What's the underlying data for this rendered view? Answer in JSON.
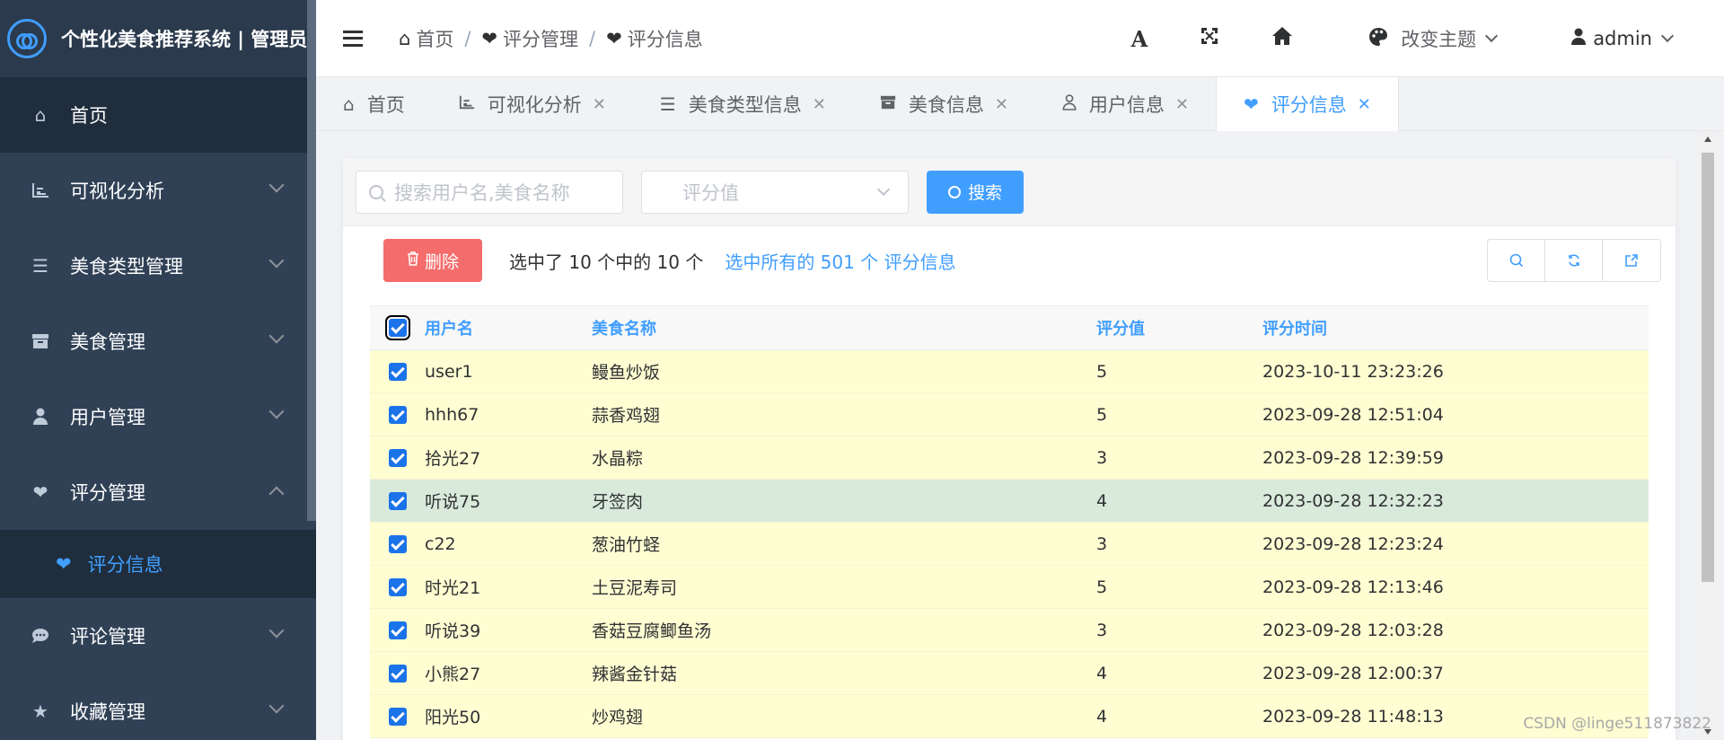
{
  "brand": {
    "title": "个性化美食推荐系统 | 管理员"
  },
  "sidebar": {
    "items": [
      {
        "label": "首页",
        "icon": "home-icon"
      },
      {
        "label": "可视化分析",
        "icon": "chart-icon"
      },
      {
        "label": "美食类型管理",
        "icon": "list-icon"
      },
      {
        "label": "美食管理",
        "icon": "box-icon"
      },
      {
        "label": "用户管理",
        "icon": "user-icon"
      },
      {
        "label": "评分管理",
        "icon": "heart-icon"
      },
      {
        "label": "评论管理",
        "icon": "comment-icon"
      },
      {
        "label": "收藏管理",
        "icon": "star-icon"
      }
    ],
    "sub_item": {
      "label": "评分信息",
      "icon": "heart-icon"
    }
  },
  "header": {
    "breadcrumb": [
      "首页",
      "评分管理",
      "评分信息"
    ],
    "theme_label": "改变主题",
    "user": "admin"
  },
  "tags": [
    {
      "label": "首页",
      "icon": "home-icon"
    },
    {
      "label": "可视化分析",
      "icon": "chart-icon"
    },
    {
      "label": "美食类型信息",
      "icon": "list-icon"
    },
    {
      "label": "美食信息",
      "icon": "box-icon"
    },
    {
      "label": "用户信息",
      "icon": "user-icon"
    },
    {
      "label": "评分信息",
      "icon": "heart-icon"
    }
  ],
  "filter": {
    "search_placeholder": "搜索用户名,美食名称",
    "score_placeholder": "评分值",
    "search_button": "搜索"
  },
  "toolbar": {
    "delete_button": "删除",
    "selection_text": "选中了 10 个中的 10 个",
    "select_all_link": "选中所有的 501 个 评分信息"
  },
  "table": {
    "headers": {
      "user": "用户名",
      "food": "美食名称",
      "score": "评分值",
      "time": "评分时间"
    },
    "rows": [
      {
        "user": "user1",
        "food": "鳗鱼炒饭",
        "score": "5",
        "time": "2023-10-11 23:23:26"
      },
      {
        "user": "hhh67",
        "food": "蒜香鸡翅",
        "score": "5",
        "time": "2023-09-28 12:51:04"
      },
      {
        "user": "拾光27",
        "food": "水晶粽",
        "score": "3",
        "time": "2023-09-28 12:39:59"
      },
      {
        "user": "听说75",
        "food": "牙签肉",
        "score": "4",
        "time": "2023-09-28 12:32:23"
      },
      {
        "user": "c22",
        "food": "葱油竹蛏",
        "score": "3",
        "time": "2023-09-28 12:23:24"
      },
      {
        "user": "时光21",
        "food": "土豆泥寿司",
        "score": "5",
        "time": "2023-09-28 12:13:46"
      },
      {
        "user": "听说39",
        "food": "香菇豆腐鲫鱼汤",
        "score": "3",
        "time": "2023-09-28 12:03:28"
      },
      {
        "user": "小熊27",
        "food": "辣酱金针菇",
        "score": "4",
        "time": "2023-09-28 12:00:37"
      },
      {
        "user": "阳光50",
        "food": "炒鸡翅",
        "score": "4",
        "time": "2023-09-28 11:48:13"
      }
    ]
  },
  "watermark": "CSDN @linge511873822",
  "colors": {
    "accent": "#409eff",
    "sidebar": "#304156",
    "danger": "#f56c6c",
    "row_bg": "#fefed2",
    "row_hover": "#d9eadb"
  }
}
